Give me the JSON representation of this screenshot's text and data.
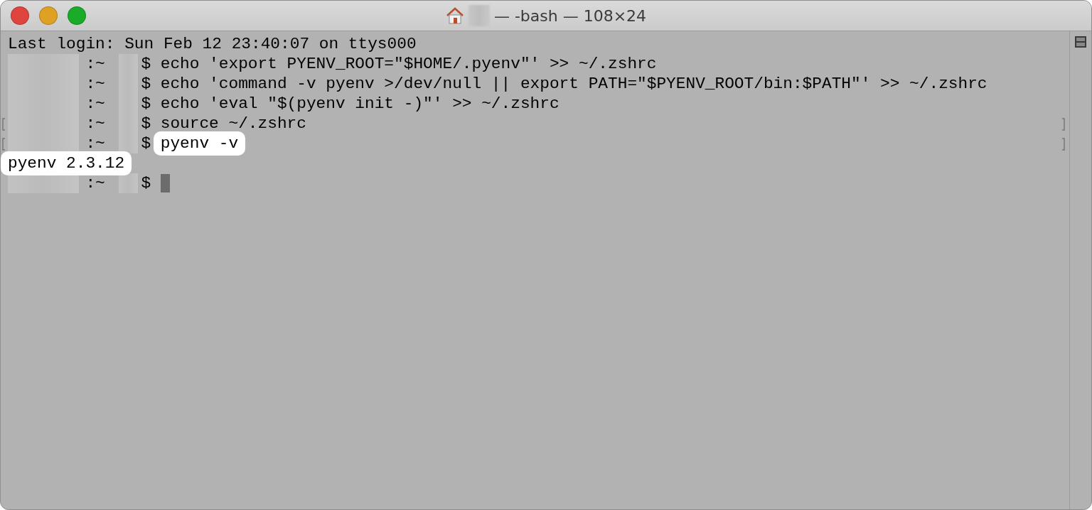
{
  "window": {
    "title": "— -bash — 108×24"
  },
  "lines": [
    {
      "kind": "output",
      "text": "Last login: Sun Feb 12 23:40:07 on ttys000",
      "highlighted": false,
      "bookmarked": false
    },
    {
      "kind": "prompt",
      "dir": ":~",
      "symbol": "$",
      "command": "echo 'export PYENV_ROOT=\"$HOME/.pyenv\"' >> ~/.zshrc",
      "highlighted": false,
      "bookmarked": false,
      "cursor": false
    },
    {
      "kind": "prompt",
      "dir": ":~",
      "symbol": "$",
      "command": "echo 'command -v pyenv >/dev/null || export PATH=\"$PYENV_ROOT/bin:$PATH\"' >> ~/.zshrc",
      "highlighted": false,
      "bookmarked": false,
      "cursor": false
    },
    {
      "kind": "prompt",
      "dir": ":~",
      "symbol": "$",
      "command": "echo 'eval \"$(pyenv init -)\"' >> ~/.zshrc",
      "highlighted": false,
      "bookmarked": false,
      "cursor": false
    },
    {
      "kind": "prompt",
      "dir": ":~",
      "symbol": "$",
      "command": "source ~/.zshrc",
      "highlighted": false,
      "bookmarked": true,
      "cursor": false
    },
    {
      "kind": "prompt",
      "dir": ":~",
      "symbol": "$",
      "command": "pyenv -v",
      "highlighted": true,
      "bookmarked": true,
      "cursor": false
    },
    {
      "kind": "output",
      "text": "pyenv 2.3.12",
      "highlighted": true,
      "bookmarked": false
    },
    {
      "kind": "prompt",
      "dir": ":~",
      "symbol": "$",
      "highlighted": false,
      "bookmarked": false,
      "cursor": true
    }
  ]
}
